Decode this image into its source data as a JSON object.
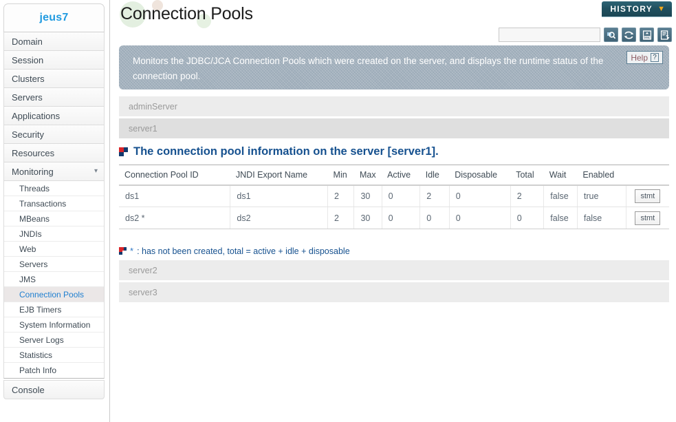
{
  "sidebar": {
    "logo": "jeus7",
    "items": [
      {
        "label": "Domain"
      },
      {
        "label": "Session"
      },
      {
        "label": "Clusters"
      },
      {
        "label": "Servers"
      },
      {
        "label": "Applications"
      },
      {
        "label": "Security"
      },
      {
        "label": "Resources"
      },
      {
        "label": "Monitoring",
        "expanded": true,
        "chevron": "chevron-down-icon"
      }
    ],
    "subitems": [
      {
        "label": "Threads",
        "active": false
      },
      {
        "label": "Transactions",
        "active": false
      },
      {
        "label": "MBeans",
        "active": false
      },
      {
        "label": "JNDIs",
        "active": false
      },
      {
        "label": "Web",
        "active": false
      },
      {
        "label": "Servers",
        "active": false
      },
      {
        "label": "JMS",
        "active": false
      },
      {
        "label": "Connection Pools",
        "active": true
      },
      {
        "label": "EJB Timers",
        "active": false
      },
      {
        "label": "System Information",
        "active": false
      },
      {
        "label": "Server Logs",
        "active": false
      },
      {
        "label": "Statistics",
        "active": false
      },
      {
        "label": "Patch Info",
        "active": false
      }
    ],
    "footer": "Console",
    "accent_color": "#1f9ae0",
    "active_color": "#1f7fd0"
  },
  "header": {
    "title": "Connection Pools",
    "history_label": "HISTORY",
    "history_chevron": "chevron-down-icon",
    "history_bg": "#20505f",
    "history_chevron_color": "#f0a81e"
  },
  "toolbar": {
    "search_value": "",
    "search_placeholder": "",
    "icons": [
      {
        "name": "search-icon",
        "title": "Search"
      },
      {
        "name": "refresh-icon",
        "title": "Refresh"
      },
      {
        "name": "xml-export-icon",
        "title": "XML"
      },
      {
        "name": "report-export-icon",
        "title": "Export"
      }
    ]
  },
  "banner": {
    "text": "Monitors the JDBC/JCA Connection Pools which were created on the server, and displays the runtime status of the connection pool.",
    "help_label": "Help",
    "help_icon": "question-mark-icon",
    "background": "#9cabb8"
  },
  "servers_top": [
    {
      "name": "adminServer"
    },
    {
      "name": "server1"
    }
  ],
  "servers_bottom": [
    {
      "name": "server2"
    },
    {
      "name": "server3"
    }
  ],
  "section": {
    "title": "The connection pool information on the server [server1].",
    "bullet_icon": "square-bullet-icon",
    "title_color": "#16518f"
  },
  "table": {
    "headers": [
      "Connection Pool ID",
      "JNDI Export Name",
      "Min",
      "Max",
      "Active",
      "Idle",
      "Disposable",
      "Total",
      "Wait",
      "Enabled",
      ""
    ],
    "rows": [
      {
        "pool_id": "ds1",
        "jndi": "ds1",
        "min": "2",
        "max": "30",
        "active": "0",
        "idle": "2",
        "disposable": "0",
        "total": "2",
        "wait": "false",
        "enabled": "true",
        "action": "stmt"
      },
      {
        "pool_id": "ds2 *",
        "jndi": "ds2",
        "min": "2",
        "max": "30",
        "active": "0",
        "idle": "0",
        "disposable": "0",
        "total": "0",
        "wait": "false",
        "enabled": "false",
        "action": "stmt"
      }
    ]
  },
  "footnote": {
    "star": "*",
    "text": ": has not been created, total = active + idle + disposable",
    "icon": "square-bullet-icon"
  }
}
